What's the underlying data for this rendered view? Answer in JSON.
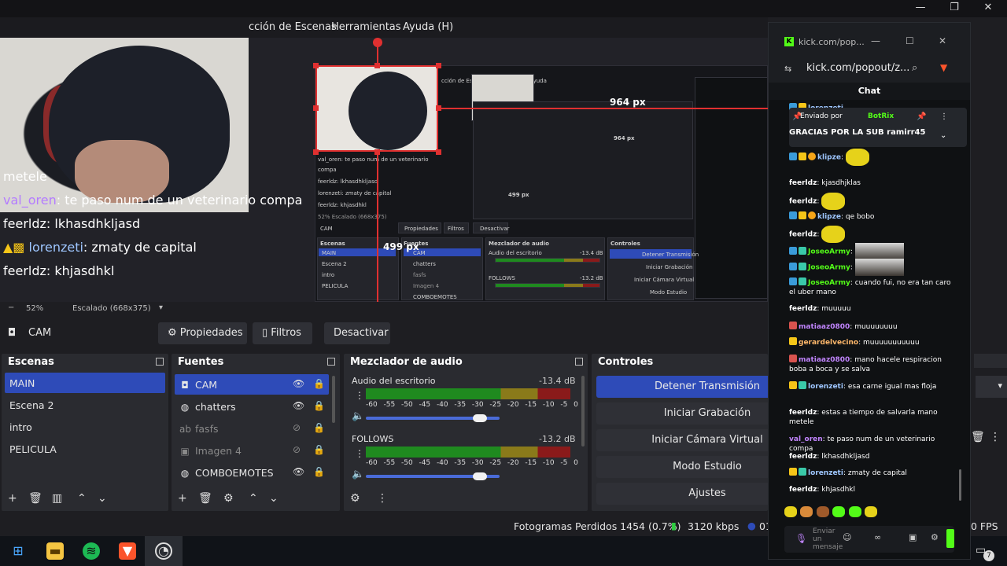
{
  "obs": {
    "window_controls": {
      "minimize": "—",
      "restore": "❐",
      "close": "✕"
    },
    "menu": [
      "cción de Escenas",
      "Herramientas",
      "Ayuda (H)"
    ],
    "preview": {
      "width_label": "964 px",
      "height_label": "499 px",
      "chat_overlay": [
        {
          "user": "",
          "text": "metele",
          "user_color": "#ffffff"
        },
        {
          "user": "val_oren",
          "text": ": te paso num de un veterinario compa",
          "user_color": "#b47cff"
        },
        {
          "user": "feerldz",
          "text": ": lkhasdhkljasd",
          "user_color": "#ffffff"
        },
        {
          "user": "lorenzeti",
          "text": ": zmaty de capital",
          "user_color": "#9ec6ff"
        },
        {
          "user": "feerldz",
          "text": ": khjasdhkl",
          "user_color": "#ffffff"
        }
      ],
      "nested": {
        "menu": "cción de Escenas   Herramientas   Ayuda",
        "overlay": [
          "val_oren: te paso num de un veterinario",
          "compa",
          "feerldz: lkhasdhkljasd",
          "lorenzeti: zmaty de capital",
          "feerldz: khjasdhkl"
        ],
        "zoom": "52%   Escalado (668x375)",
        "source": "CAM",
        "buttons": [
          "Propiedades",
          "Filtros",
          "Desactivar"
        ],
        "scenes_title": "Escenas",
        "scenes": [
          "MAIN",
          "Escena 2",
          "intro",
          "PELICULA"
        ],
        "sources_title": "Fuentes",
        "sources": [
          "CAM",
          "chatters",
          "fasfs",
          "Imagen 4",
          "COMBOEMOTES"
        ],
        "audio_title": "Mezclador de audio",
        "audio": [
          {
            "name": "Audio del escritorio",
            "db": "-13.4 dB"
          },
          {
            "name": "FOLLOWS",
            "db": "-13.2 dB"
          }
        ],
        "controls_title": "Controles",
        "controls": [
          "Detener Transmisión",
          "Iniciar Grabación",
          "Iniciar Cámara Virtual",
          "Modo Estudio"
        ],
        "label_964": "964 px",
        "label_499": "499 px"
      }
    },
    "zoom": {
      "minus": "−",
      "percent": "52%",
      "scaling": "Escalado (668x375)"
    },
    "source_toolbar": {
      "source_name": "CAM",
      "properties": "Propiedades",
      "filters": "Filtros",
      "deactivate": "Desactivar"
    },
    "scenes": {
      "title": "Escenas",
      "items": [
        "MAIN",
        "Escena 2",
        "intro",
        "PELICULA"
      ],
      "selected": "MAIN"
    },
    "sources": {
      "title": "Fuentes",
      "items": [
        {
          "name": "CAM",
          "icon": "camera-icon",
          "visible": true
        },
        {
          "name": "chatters",
          "icon": "globe-icon",
          "visible": true
        },
        {
          "name": "fasfs",
          "icon": "text-icon",
          "visible": false
        },
        {
          "name": "Imagen 4",
          "icon": "image-icon",
          "visible": false
        },
        {
          "name": "COMBOEMOTES",
          "icon": "globe-icon",
          "visible": true
        }
      ]
    },
    "audio_mixer": {
      "title": "Mezclador de audio",
      "channels": [
        {
          "name": "Audio del escritorio",
          "db": "-13.4 dB",
          "volume": 0.85
        },
        {
          "name": "FOLLOWS",
          "db": "-13.2 dB",
          "volume": 0.85
        }
      ],
      "ticks": [
        "-60",
        "-55",
        "-50",
        "-45",
        "-40",
        "-35",
        "-30",
        "-25",
        "-20",
        "-15",
        "-10",
        "-5",
        "0"
      ]
    },
    "controls": {
      "title": "Controles",
      "stop_stream": "Detener Transmisión",
      "start_recording": "Iniciar Grabación",
      "start_virtual_cam": "Iniciar Cámara Virtual",
      "studio_mode": "Modo Estudio",
      "settings": "Ajustes"
    },
    "status": {
      "dropped_frames": "Fotogramas Perdidos 1454 (0.7%)",
      "bitrate": "3120 kbps",
      "live_time_prefix": "01",
      "fps_suffix": "0 FPS"
    }
  },
  "kick": {
    "window_title": "kick.com/pop...",
    "url": "kick.com/popout/z...",
    "chat_title": "Chat",
    "pinned": {
      "by": "Enviado por",
      "bot": "BotRix",
      "text": "GRACIAS POR LA SUB ramirr45"
    },
    "messages": [
      {
        "user": "lorenzeti",
        "text": "",
        "color": "#9ec6ff"
      },
      {
        "user": "klipze",
        "text": "",
        "color": "#9ec6ff"
      },
      {
        "user": "feerldz",
        "text": "kjasdhjklas",
        "color": "#ffffff"
      },
      {
        "user": "feerldz",
        "text": "",
        "color": "#ffffff"
      },
      {
        "user": "klipze",
        "text": "qe bobo",
        "color": "#9ec6ff"
      },
      {
        "user": "feerldz",
        "text": "",
        "color": "#ffffff"
      },
      {
        "user": "JoseoArmy",
        "text": "",
        "color": "#53fc18"
      },
      {
        "user": "JoseoArmy",
        "text": "",
        "color": "#53fc18"
      },
      {
        "user": "JoseoArmy",
        "text": "cuando fui, no era tan caro el uber mano",
        "color": "#53fc18"
      },
      {
        "user": "feerldz",
        "text": "muuuuu",
        "color": "#ffffff"
      },
      {
        "user": "matiaaz0800",
        "text": "muuuuuuuu",
        "color": "#c084fc"
      },
      {
        "user": "gerardelvecino",
        "text": "muuuuuuuuuuu",
        "color": "#ffb86b"
      },
      {
        "user": "matiaaz0800",
        "text": "mano hacele respiracion boba a boca y se salva",
        "color": "#c084fc"
      },
      {
        "user": "lorenzeti",
        "text": "esa carne igual mas floja",
        "color": "#9ec6ff"
      },
      {
        "user": "feerldz",
        "text": "estas a tiempo de salvarla mano metele",
        "color": "#ffffff"
      },
      {
        "user": "val_oren",
        "text": "te paso num de un veterinario compa",
        "color": "#c084fc"
      },
      {
        "user": "feerldz",
        "text": "lkhasdhkljasd",
        "color": "#ffffff"
      },
      {
        "user": "lorenzeti",
        "text": "zmaty de capital",
        "color": "#9ec6ff"
      },
      {
        "user": "feerldz",
        "text": "khjasdhkl",
        "color": "#ffffff"
      }
    ],
    "input_placeholder": "Enviar un mensaje",
    "taskbar_badge": "7"
  },
  "colors": {
    "accent": "#2e4bb8",
    "kick_green": "#53fc18",
    "selection_red": "#e03030"
  }
}
